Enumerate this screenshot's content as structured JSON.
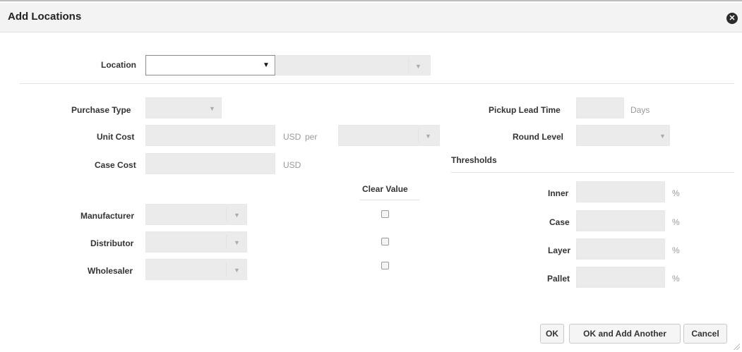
{
  "dialog": {
    "title": "Add Locations",
    "close_icon": "close-icon"
  },
  "location": {
    "label": "Location",
    "value": "",
    "secondary_value": ""
  },
  "left": {
    "purchase_type_label": "Purchase Type",
    "unit_cost_label": "Unit Cost",
    "unit_cost_currency": "USD",
    "unit_cost_per": "per",
    "case_cost_label": "Case Cost",
    "case_cost_currency": "USD"
  },
  "clear_value": {
    "header": "Clear Value"
  },
  "suppliers": {
    "manufacturer_label": "Manufacturer",
    "distributor_label": "Distributor",
    "wholesaler_label": "Wholesaler"
  },
  "right": {
    "pickup_lead_time_label": "Pickup Lead Time",
    "pickup_lead_time_unit": "Days",
    "round_level_label": "Round Level",
    "thresholds_label": "Thresholds"
  },
  "thresholds": {
    "inner_label": "Inner",
    "case_label": "Case",
    "layer_label": "Layer",
    "pallet_label": "Pallet",
    "percent": "%"
  },
  "buttons": {
    "ok": "OK",
    "ok_add_another": "OK and Add Another",
    "cancel": "Cancel"
  }
}
